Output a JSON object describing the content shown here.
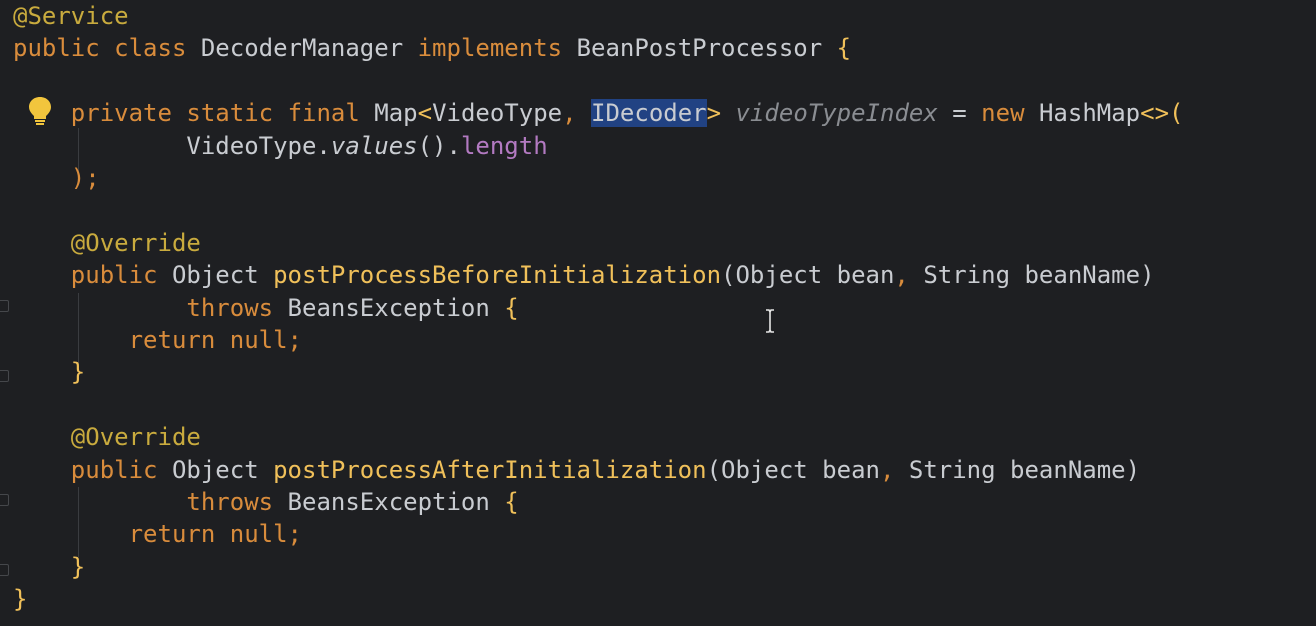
{
  "editor": {
    "lines": [
      {
        "tokens": [
          {
            "t": "@Service",
            "c": "annotation"
          }
        ]
      },
      {
        "tokens": [
          {
            "t": "public",
            "c": "keyword"
          },
          {
            "t": " ",
            "c": "plain"
          },
          {
            "t": "class",
            "c": "keyword"
          },
          {
            "t": " DecoderManager ",
            "c": "plain"
          },
          {
            "t": "implements",
            "c": "keyword"
          },
          {
            "t": " BeanPostProcessor ",
            "c": "plain"
          },
          {
            "t": "{",
            "c": "brace"
          }
        ]
      },
      {
        "tokens": []
      },
      {
        "tokens": [
          {
            "t": "    ",
            "c": "plain"
          },
          {
            "t": "private",
            "c": "keyword"
          },
          {
            "t": " ",
            "c": "plain"
          },
          {
            "t": "static",
            "c": "keyword"
          },
          {
            "t": " ",
            "c": "plain"
          },
          {
            "t": "final",
            "c": "keyword"
          },
          {
            "t": " Map",
            "c": "plain"
          },
          {
            "t": "<",
            "c": "angle"
          },
          {
            "t": "VideoType",
            "c": "plain"
          },
          {
            "t": ", ",
            "c": "comma"
          },
          {
            "t": "IDecoder",
            "c": "highlight"
          },
          {
            "t": ">",
            "c": "angle"
          },
          {
            "t": " ",
            "c": "plain"
          },
          {
            "t": "videoTypeIndex",
            "c": "field"
          },
          {
            "t": " = ",
            "c": "plain"
          },
          {
            "t": "new",
            "c": "keyword"
          },
          {
            "t": " HashMap",
            "c": "plain"
          },
          {
            "t": "<>(",
            "c": "angle"
          }
        ]
      },
      {
        "tokens": [
          {
            "t": "            VideoType.",
            "c": "plain"
          },
          {
            "t": "values",
            "c": "static-call"
          },
          {
            "t": "().",
            "c": "plain"
          },
          {
            "t": "length",
            "c": "member"
          }
        ]
      },
      {
        "tokens": [
          {
            "t": "    );",
            "c": "keyword"
          }
        ]
      },
      {
        "tokens": []
      },
      {
        "tokens": [
          {
            "t": "    ",
            "c": "plain"
          },
          {
            "t": "@Override",
            "c": "annotation"
          }
        ]
      },
      {
        "tokens": [
          {
            "t": "    ",
            "c": "plain"
          },
          {
            "t": "public",
            "c": "keyword"
          },
          {
            "t": " Object ",
            "c": "plain"
          },
          {
            "t": "postProcessBeforeInitialization",
            "c": "method"
          },
          {
            "t": "(Object bean",
            "c": "plain"
          },
          {
            "t": ", ",
            "c": "comma"
          },
          {
            "t": "String beanName)",
            "c": "plain"
          }
        ]
      },
      {
        "tokens": [
          {
            "t": "            ",
            "c": "plain"
          },
          {
            "t": "throws",
            "c": "keyword"
          },
          {
            "t": " BeansException ",
            "c": "plain"
          },
          {
            "t": "{",
            "c": "brace"
          }
        ]
      },
      {
        "tokens": [
          {
            "t": "        ",
            "c": "plain"
          },
          {
            "t": "return",
            "c": "keyword"
          },
          {
            "t": " ",
            "c": "plain"
          },
          {
            "t": "null;",
            "c": "keyword"
          }
        ]
      },
      {
        "tokens": [
          {
            "t": "    ",
            "c": "plain"
          },
          {
            "t": "}",
            "c": "brace"
          }
        ]
      },
      {
        "tokens": []
      },
      {
        "tokens": [
          {
            "t": "    ",
            "c": "plain"
          },
          {
            "t": "@Override",
            "c": "annotation"
          }
        ]
      },
      {
        "tokens": [
          {
            "t": "    ",
            "c": "plain"
          },
          {
            "t": "public",
            "c": "keyword"
          },
          {
            "t": " Object ",
            "c": "plain"
          },
          {
            "t": "postProcessAfterInitialization",
            "c": "method"
          },
          {
            "t": "(Object bean",
            "c": "plain"
          },
          {
            "t": ", ",
            "c": "comma"
          },
          {
            "t": "String beanName)",
            "c": "plain"
          }
        ]
      },
      {
        "tokens": [
          {
            "t": "            ",
            "c": "plain"
          },
          {
            "t": "throws",
            "c": "keyword"
          },
          {
            "t": " BeansException ",
            "c": "plain"
          },
          {
            "t": "{",
            "c": "brace"
          }
        ]
      },
      {
        "tokens": [
          {
            "t": "        ",
            "c": "plain"
          },
          {
            "t": "return",
            "c": "keyword"
          },
          {
            "t": " ",
            "c": "plain"
          },
          {
            "t": "null;",
            "c": "keyword"
          }
        ]
      },
      {
        "tokens": [
          {
            "t": "    ",
            "c": "plain"
          },
          {
            "t": "}",
            "c": "brace"
          }
        ]
      },
      {
        "tokens": [
          {
            "t": "}",
            "c": "brace"
          }
        ]
      }
    ]
  },
  "icons": {
    "intention": "lightbulb-icon",
    "cursor": "text-cursor-icon"
  },
  "colors": {
    "background": "#1e1f22",
    "keyword": "#d98c3c",
    "annotation": "#c9ab3e",
    "method": "#f0c05a",
    "text": "#c9ccd1",
    "field": "#8a8d92",
    "member": "#b37ac2",
    "selection": "#214283"
  }
}
